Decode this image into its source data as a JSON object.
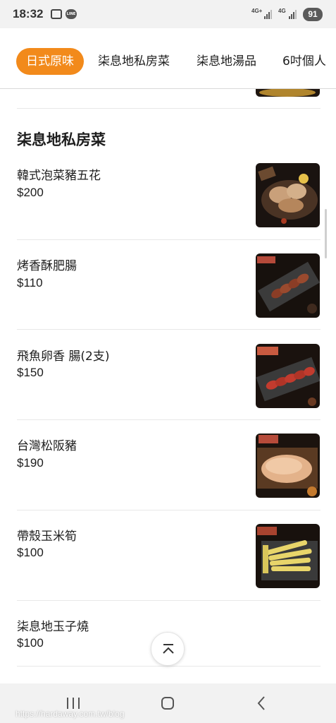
{
  "status_bar": {
    "time": "18:32",
    "net1": "4G+",
    "net2": "4G",
    "battery": "91",
    "icons": [
      "camera-icon",
      "line-app-icon",
      "signal-icon",
      "battery-icon"
    ]
  },
  "tabs": [
    {
      "label": "日式原味",
      "active": true
    },
    {
      "label": "柒息地私房菜",
      "active": false
    },
    {
      "label": "柒息地湯品",
      "active": false
    },
    {
      "label": "6吋個人",
      "active": false
    }
  ],
  "section": {
    "title": "柒息地私房菜"
  },
  "items": [
    {
      "name": "韓式泡菜豬五花",
      "price": "$200",
      "image": "kimchi-pork-belly-photo"
    },
    {
      "name": "烤香酥肥腸",
      "price": "$110",
      "image": "grilled-intestine-photo"
    },
    {
      "name": "飛魚卵香 腸(2支)",
      "price": "$150",
      "image": "sausage-photo"
    },
    {
      "name": "台灣松阪豬",
      "price": "$190",
      "image": "pork-neck-photo"
    },
    {
      "name": "帶殼玉米筍",
      "price": "$100",
      "image": "baby-corn-photo"
    },
    {
      "name": "柒息地玉子燒",
      "price": "$100",
      "image": ""
    }
  ],
  "floating": {
    "back_to_top_icon": "chevron-up-icon"
  },
  "nav_bar": {
    "icons": [
      "recent-apps-icon",
      "home-icon",
      "back-icon"
    ]
  },
  "watermark": "https://hardaway.com.tw/blog",
  "colors": {
    "accent": "#f28a1b",
    "text": "#1d1d1d",
    "divider": "#e8e8e8"
  }
}
